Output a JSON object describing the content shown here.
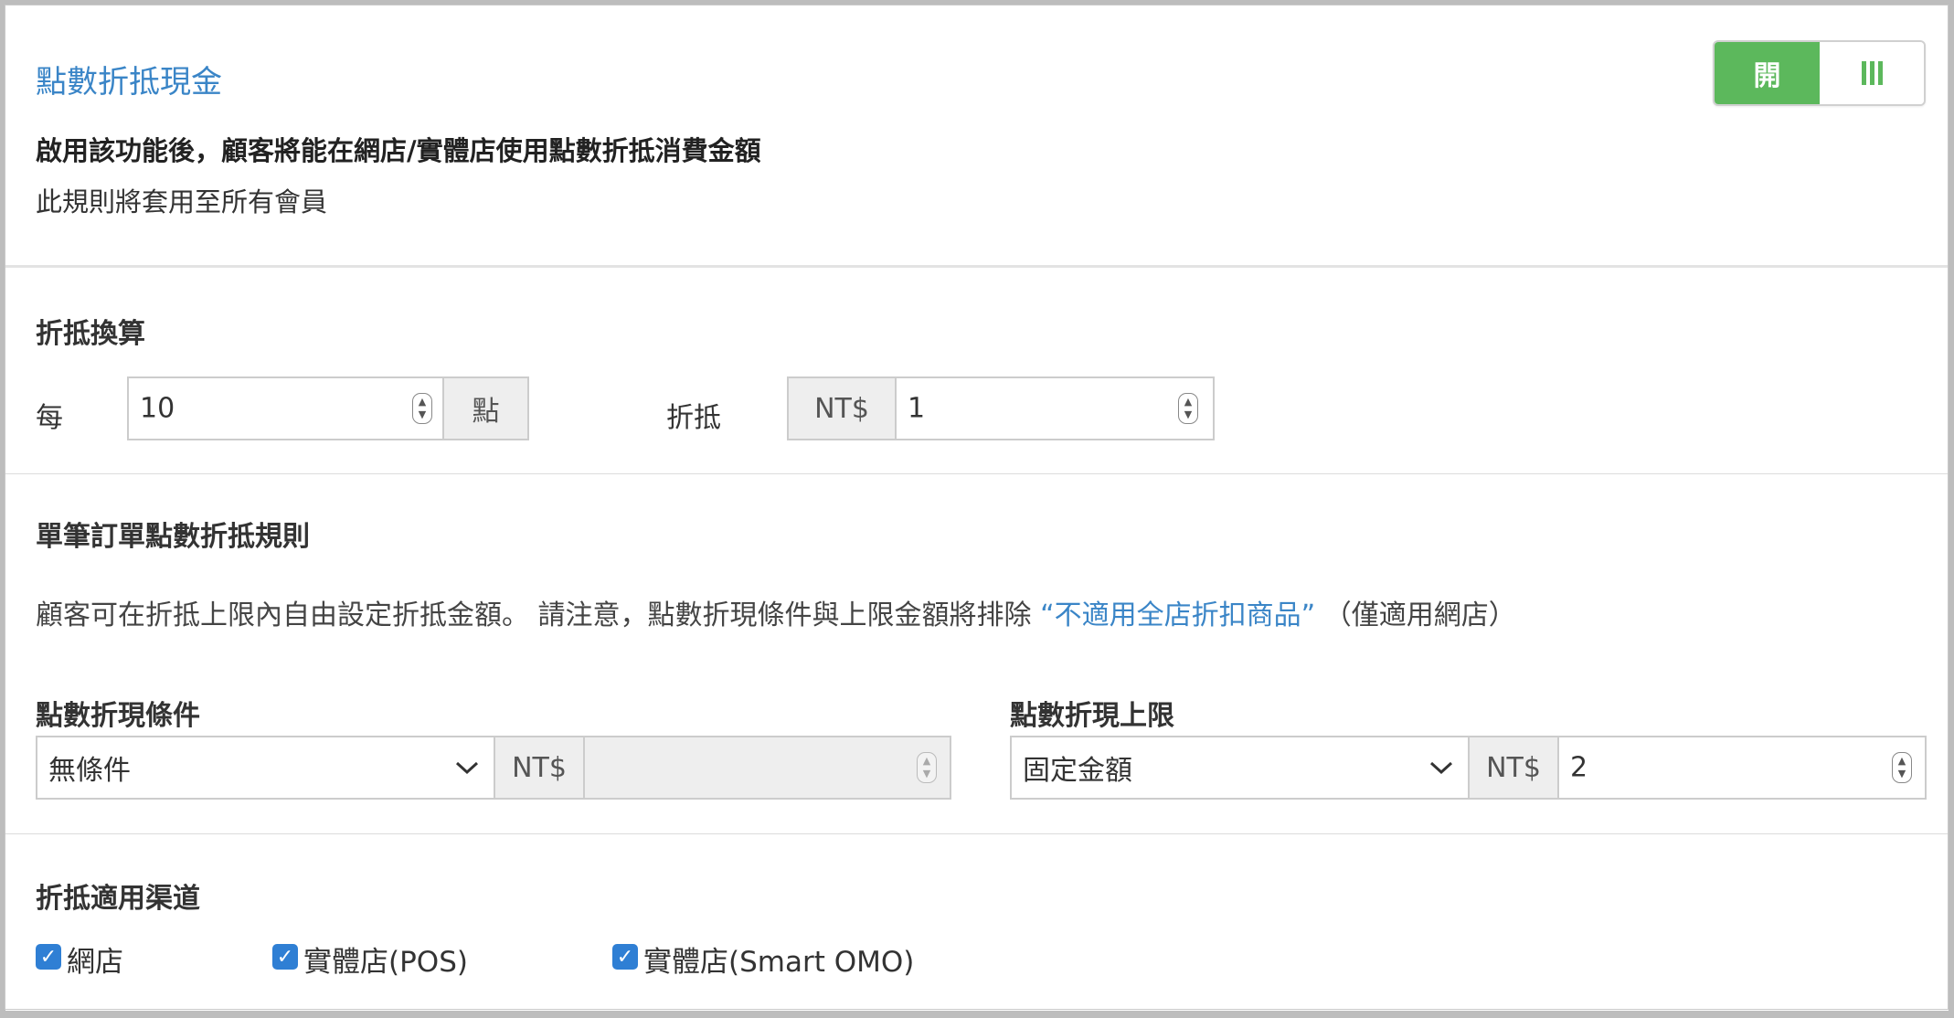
{
  "header": {
    "title": "點數折抵現金",
    "description_bold": "啟用該功能後，顧客將能在網店/實體店使用點數折抵消費金額",
    "description": "此規則將套用至所有會員",
    "toggle": {
      "on_label": "開",
      "state": "on",
      "color": "#5cb85c"
    }
  },
  "conversion": {
    "heading": "折抵換算",
    "per_label": "每",
    "points_value": "10",
    "points_unit": "點",
    "offset_label": "折抵",
    "currency": "NT$",
    "amount_value": "1"
  },
  "order_rules": {
    "heading": "單筆訂單點數折抵規則",
    "note_prefix": "顧客可在折抵上限內自由設定折抵金額。 請注意，點數折現條件與上限金額將排除 ",
    "note_link": "“不適用全店折扣商品”",
    "note_suffix": " （僅適用網店）",
    "condition": {
      "label": "點數折現條件",
      "selected": "無條件",
      "currency": "NT$",
      "value": ""
    },
    "limit": {
      "label": "點數折現上限",
      "selected": "固定金額",
      "currency": "NT$",
      "value": "2"
    }
  },
  "channels": {
    "heading": "折抵適用渠道",
    "options": [
      {
        "label": "網店",
        "checked": true
      },
      {
        "label": "實體店(POS)",
        "checked": true
      },
      {
        "label": "實體店(Smart OMO)",
        "checked": true
      }
    ]
  },
  "colors": {
    "accent": "#3a85c7",
    "checkbox": "#2f7fd4"
  }
}
